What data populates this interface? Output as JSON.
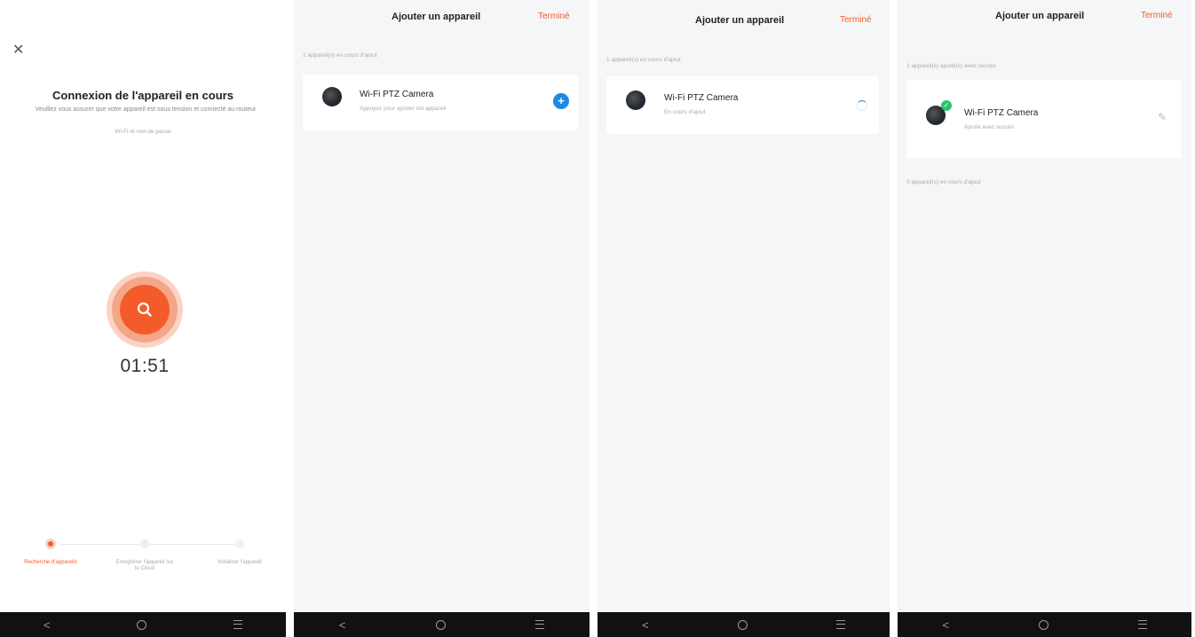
{
  "panel1": {
    "close_icon": "✕",
    "title": "Connexion de l'appareil en cours",
    "description": "Veuillez vous assurer que votre appareil est sous tension et connecté au routeur",
    "sub": "Wi-Fi et mot de passe",
    "timer": "01:51",
    "steps": [
      {
        "label": "Recherche d'appareils",
        "state": "active"
      },
      {
        "label": "Enregistrer l'appareil sur le Cloud",
        "state": "pending"
      },
      {
        "label": "Initialiser l'appareil",
        "state": "pending"
      }
    ],
    "accent_color": "#f45b2b"
  },
  "panel2": {
    "header_title": "Ajouter un appareil",
    "header_action": "Terminé",
    "section_label": "1 appareil(s) en cours d'ajout",
    "device_name": "Wi-Fi PTZ Camera",
    "device_status": "Appuyez pour ajouter cet appareil",
    "action_icon": "plus-circle"
  },
  "panel3": {
    "header_title": "Ajouter un appareil",
    "header_action": "Terminé",
    "section_label": "1 appareil(s) en cours d'ajout",
    "device_name": "Wi-Fi PTZ Camera",
    "device_status": "En cours d'ajout",
    "action_icon": "spinner"
  },
  "panel4": {
    "header_title": "Ajouter un appareil",
    "header_action": "Terminé",
    "section_label": "1 appareil(s) ajouté(s) avec succès",
    "device_name": "Wi-Fi PTZ Camera",
    "device_status": "Ajouté avec succès",
    "action_icon": "pencil-icon",
    "section_label_2": "0 appareil(s) en cours d'ajout"
  },
  "navbar": {
    "back": "<",
    "home": "○",
    "menu": "≡"
  }
}
